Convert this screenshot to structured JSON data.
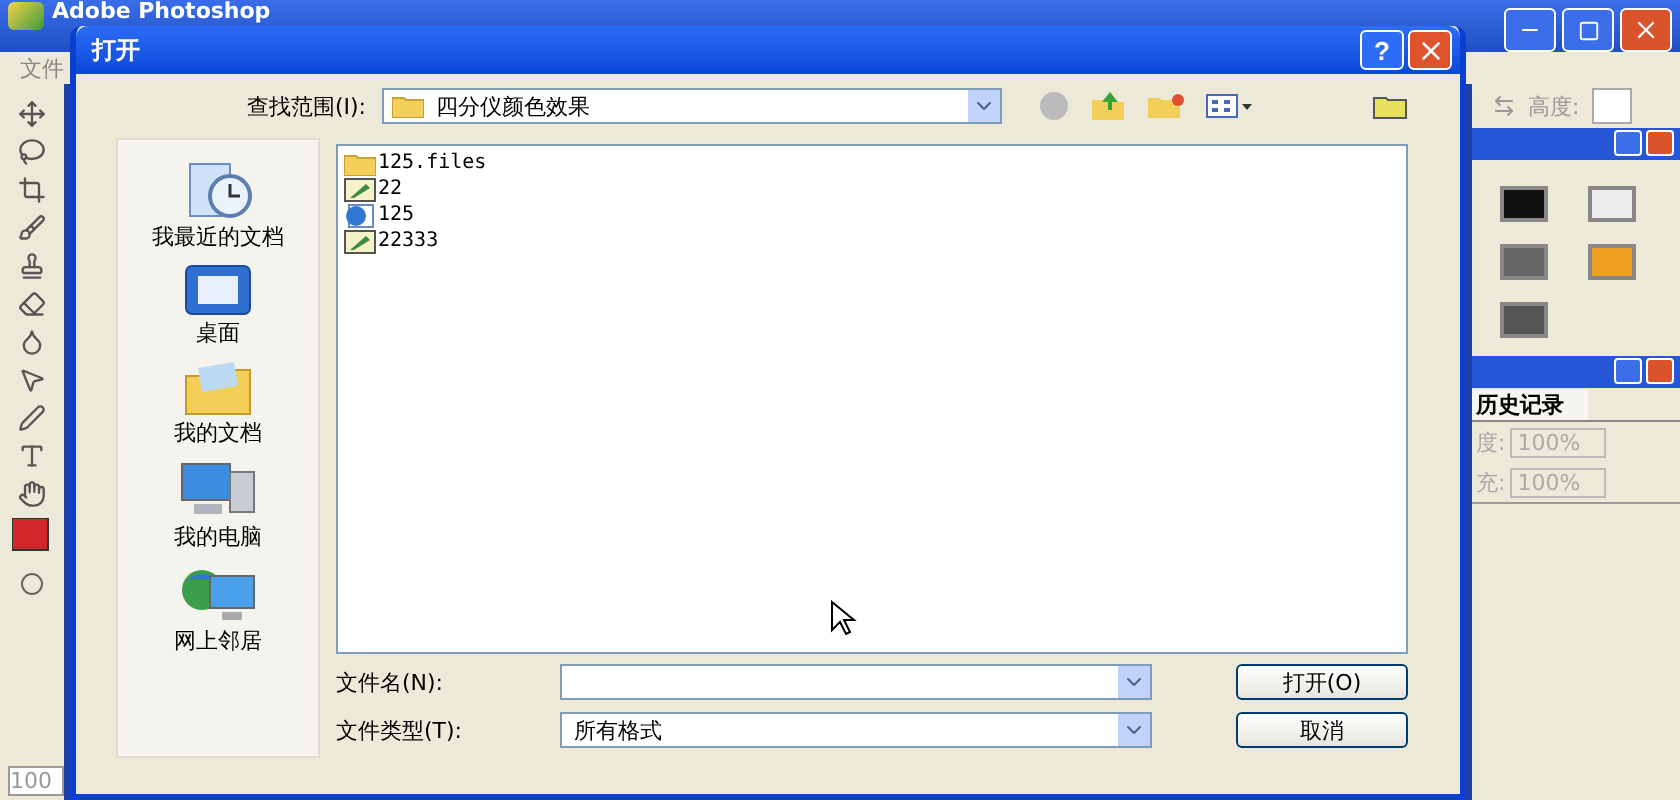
{
  "background_app": {
    "title": "Adobe Photoshop",
    "menu": [
      "文件"
    ],
    "options_label": "高度:",
    "history_panel": {
      "tab": "历史记录",
      "rows": [
        {
          "label": "度:",
          "value": "100%"
        },
        {
          "label": "充:",
          "value": "100%"
        }
      ]
    },
    "zoom_field": "100"
  },
  "dialog": {
    "title": "打开",
    "help_glyph": "?",
    "look_in": {
      "label": "查找范围(I):",
      "value": "四分仪颜色效果"
    },
    "places": [
      {
        "label": "我最近的文档",
        "kind": "recent"
      },
      {
        "label": "桌面",
        "kind": "desktop"
      },
      {
        "label": "我的文档",
        "kind": "documents"
      },
      {
        "label": "我的电脑",
        "kind": "computer"
      },
      {
        "label": "网上邻居",
        "kind": "network"
      }
    ],
    "files": [
      {
        "name": "125.files",
        "kind": "folder"
      },
      {
        "name": "22",
        "kind": "image"
      },
      {
        "name": "125",
        "kind": "web"
      },
      {
        "name": "22333",
        "kind": "image"
      }
    ],
    "file_name": {
      "label": "文件名(N):"
    },
    "file_type": {
      "label": "文件类型(T):",
      "value": "所有格式"
    },
    "buttons": [
      "打开(O)",
      "取消"
    ]
  }
}
